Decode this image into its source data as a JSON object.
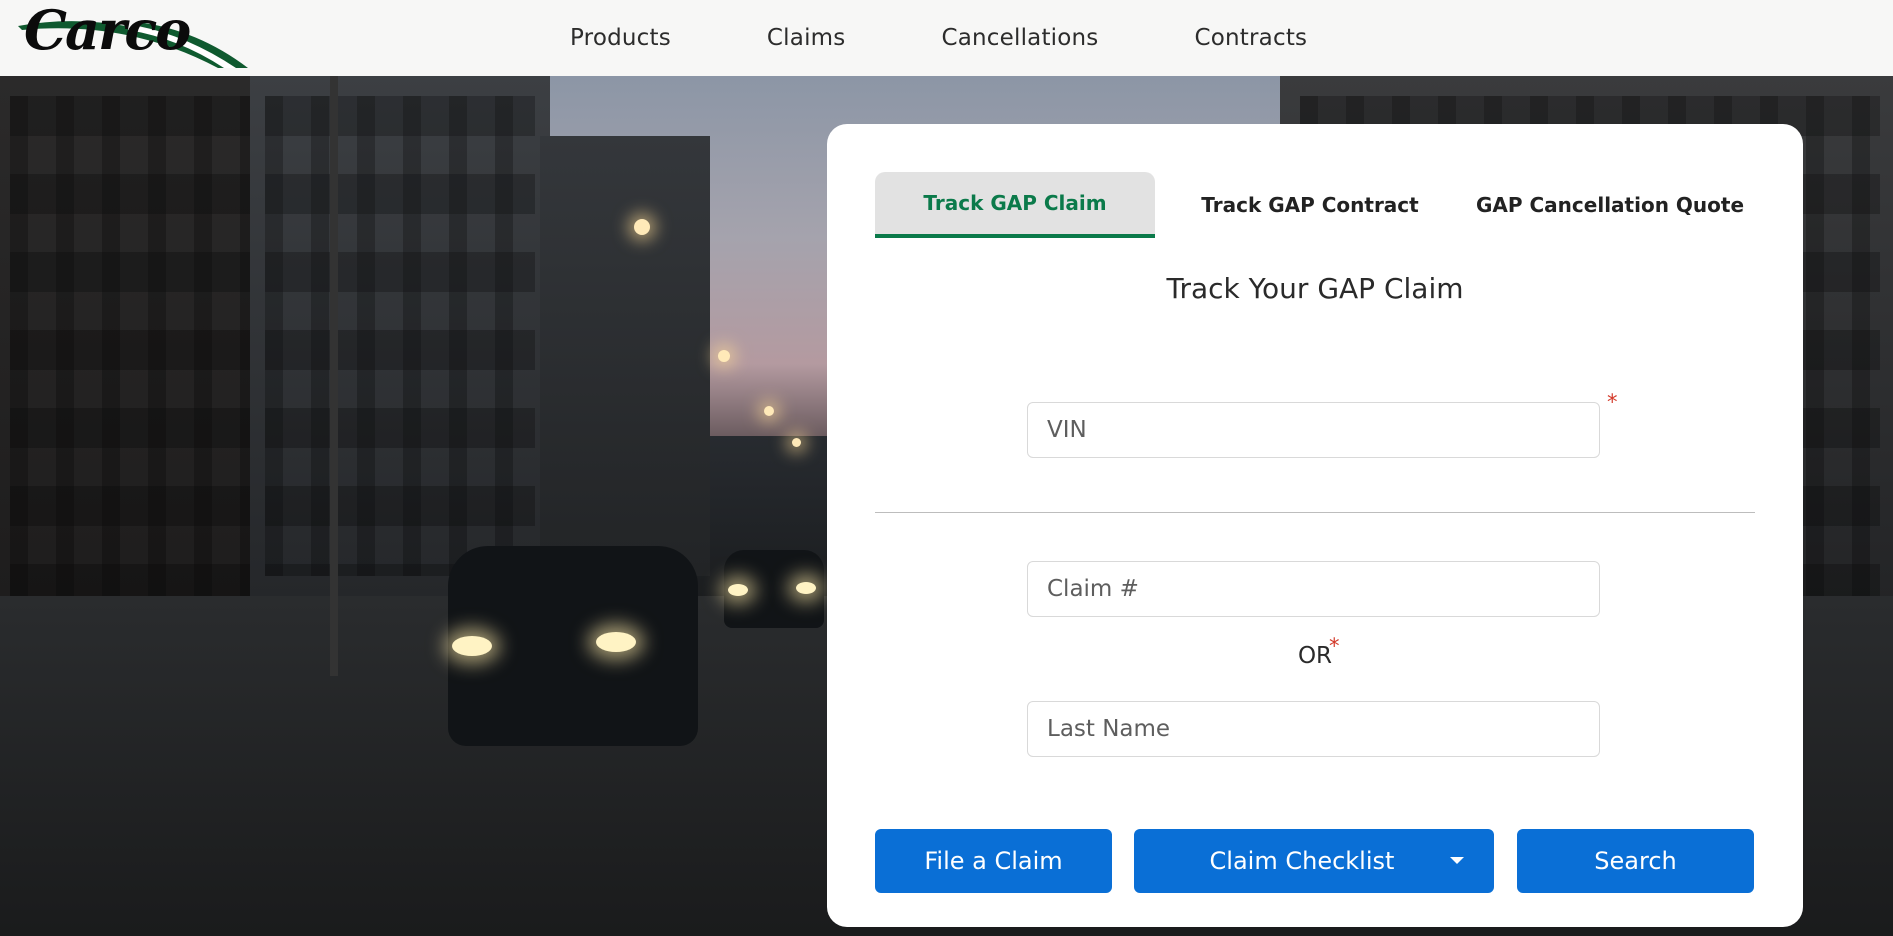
{
  "header": {
    "logo_text": "Carco",
    "nav": [
      "Products",
      "Claims",
      "Cancellations",
      "Contracts"
    ]
  },
  "card": {
    "tabs": [
      "Track GAP Claim",
      "Track GAP Contract",
      "GAP Cancellation Quote"
    ],
    "active_tab": "Track GAP Claim",
    "title": "Track Your GAP Claim",
    "fields": {
      "vin": {
        "placeholder": "VIN",
        "value": ""
      },
      "claim_number": {
        "placeholder": "Claim #",
        "value": ""
      },
      "last_name": {
        "placeholder": "Last Name",
        "value": ""
      }
    },
    "required_marker": "*",
    "or_label": "OR",
    "buttons": {
      "file_claim": "File a Claim",
      "claim_checklist": "Claim Checklist",
      "search": "Search"
    }
  },
  "colors": {
    "brand_green": "#0b7a4a",
    "button_blue": "#0a6fd6",
    "required_red": "#d43a2a"
  }
}
